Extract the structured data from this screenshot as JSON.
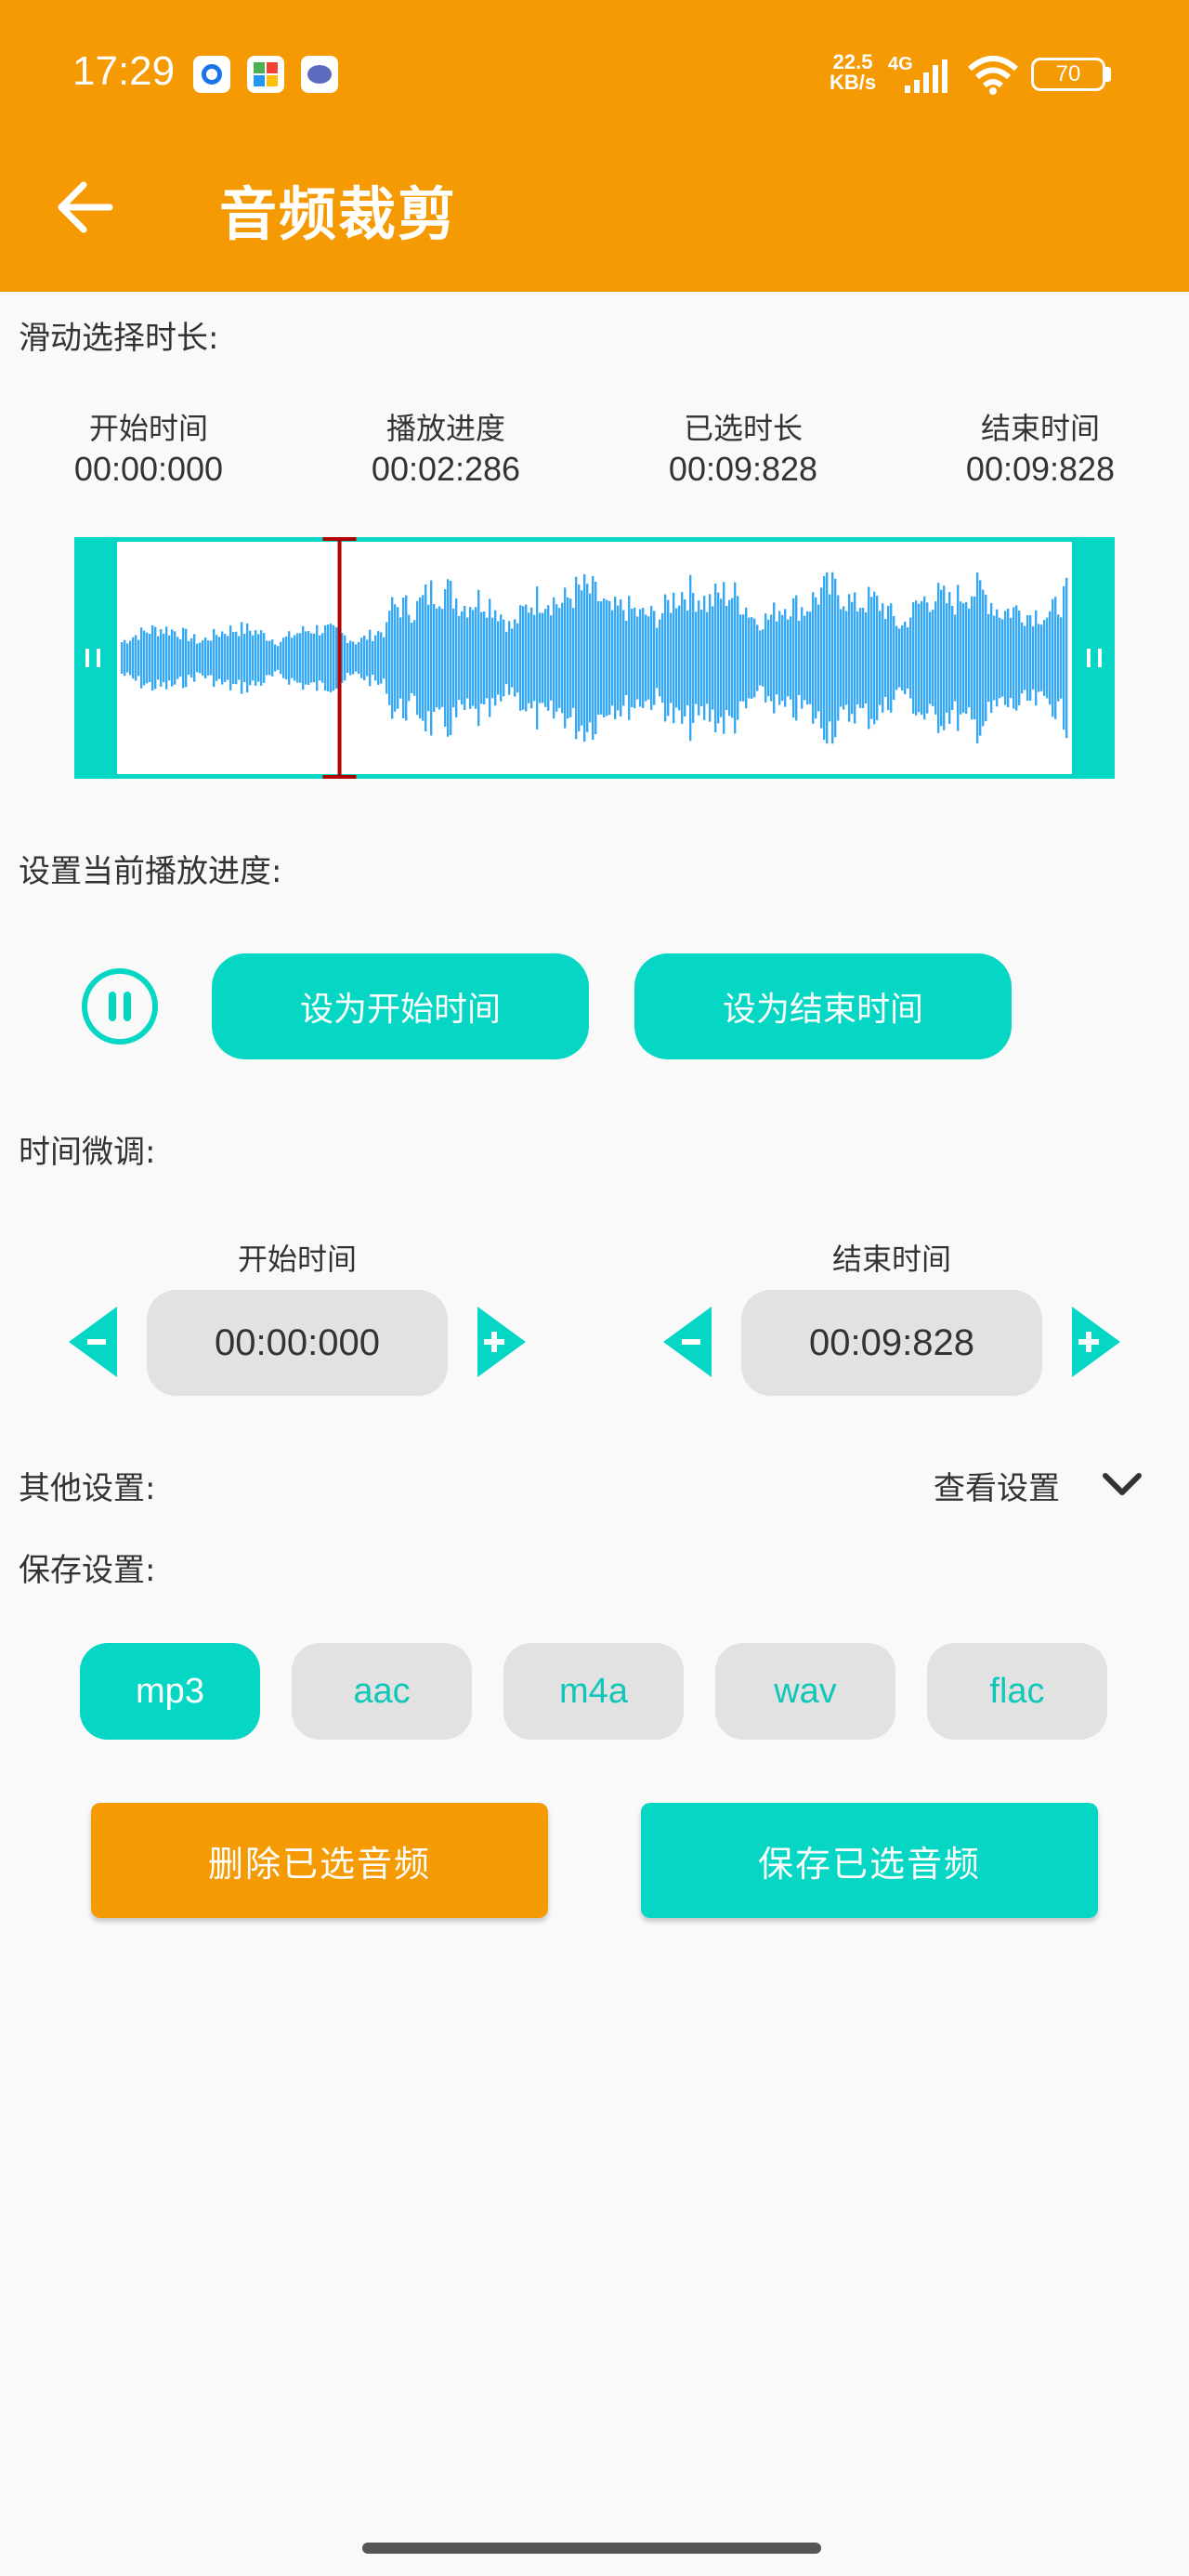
{
  "status_bar": {
    "time": "17:29",
    "net_speed_value": "22.5",
    "net_speed_unit": "KB/s",
    "network": "4G",
    "battery": "70"
  },
  "header": {
    "title": "音频裁剪"
  },
  "slide": {
    "label": "滑动选择时长:",
    "stats": [
      {
        "label": "开始时间",
        "value": "00:00:000"
      },
      {
        "label": "播放进度",
        "value": "00:02:286"
      },
      {
        "label": "已选时长",
        "value": "00:09:828"
      },
      {
        "label": "结束时间",
        "value": "00:09:828"
      }
    ],
    "playhead_fraction": 0.233
  },
  "progress": {
    "label": "设置当前播放进度:",
    "set_start": "设为开始时间",
    "set_end": "设为结束时间"
  },
  "finetune": {
    "label": "时间微调:",
    "start_label": "开始时间",
    "start_value": "00:00:000",
    "end_label": "结束时间",
    "end_value": "00:09:828"
  },
  "other": {
    "label": "其他设置:",
    "view": "查看设置"
  },
  "save": {
    "label": "保存设置:",
    "formats": [
      "mp3",
      "aac",
      "m4a",
      "wav",
      "flac"
    ],
    "selected": "mp3",
    "delete_btn": "删除已选音频",
    "save_btn": "保存已选音频"
  },
  "colors": {
    "header": "#f59a03",
    "accent": "#06d6c4",
    "wave": "#36a8f4",
    "playhead": "#b00000",
    "delete": "#f59a03"
  }
}
